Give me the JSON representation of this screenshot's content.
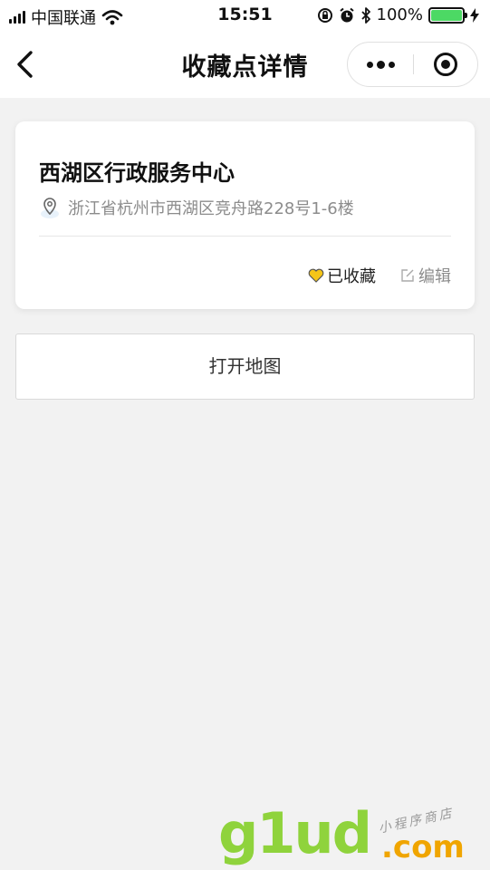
{
  "status_bar": {
    "carrier": "中国联通",
    "time": "15:51",
    "battery_pct": "100%",
    "battery_level": 1.0
  },
  "nav": {
    "title": "收藏点详情",
    "back_icon": "chevron-left-icon",
    "more_icon": "more-dots-icon",
    "close_icon": "target-circle-icon"
  },
  "place": {
    "name": "西湖区行政服务中心",
    "address": "浙江省杭州市西湖区竞舟路228号1-6楼",
    "favorite_label": "已收藏",
    "edit_label": "编辑"
  },
  "map_button": {
    "label": "打开地图"
  },
  "watermark": {
    "brand": "g1ud",
    "suffix": ".com",
    "tagline": "小程序商店"
  },
  "colors": {
    "accent_favorite": "#f5c518",
    "battery": "#4cd964",
    "watermark_green": "#8fd33c",
    "watermark_orange": "#f0a500"
  }
}
